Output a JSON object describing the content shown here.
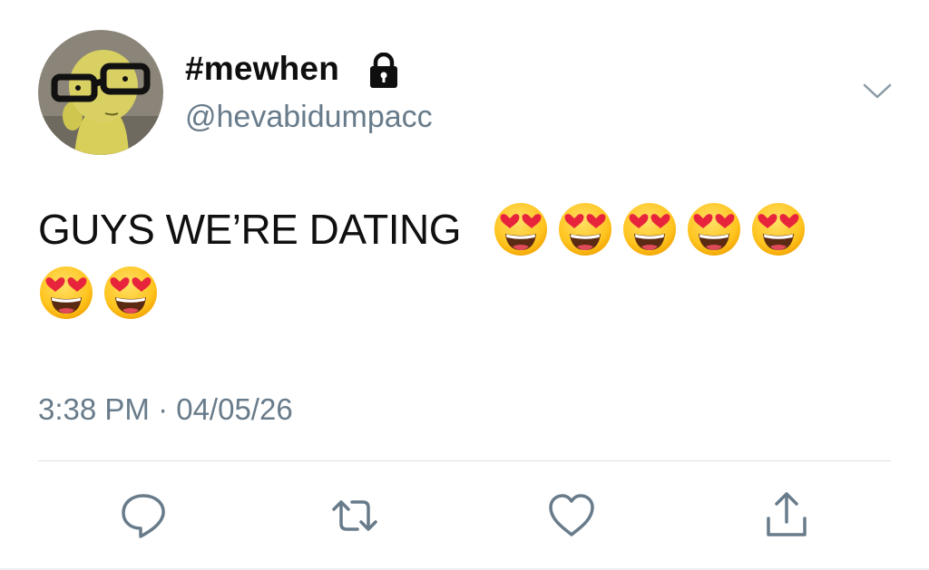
{
  "author": {
    "display_name": "#mewhen",
    "handle": "@hevabidumpacc",
    "avatar_icon": "avatar-image",
    "protected_icon": "lock-icon"
  },
  "tweet": {
    "text": "GUYS WE’RE DATING",
    "emoji": "smiling-face-with-heart-eyes",
    "emoji_count": 7,
    "timestamp": "3:38 PM · 04/05/26"
  },
  "actions": [
    {
      "name": "reply",
      "icon": "comment-icon"
    },
    {
      "name": "retweet",
      "icon": "retweet-icon"
    },
    {
      "name": "like",
      "icon": "heart-icon"
    },
    {
      "name": "share",
      "icon": "share-icon"
    }
  ],
  "colors": {
    "text_primary": "#101010",
    "text_secondary": "#687b8a",
    "icon": "#687b8a",
    "divider": "#dcdfe3"
  }
}
